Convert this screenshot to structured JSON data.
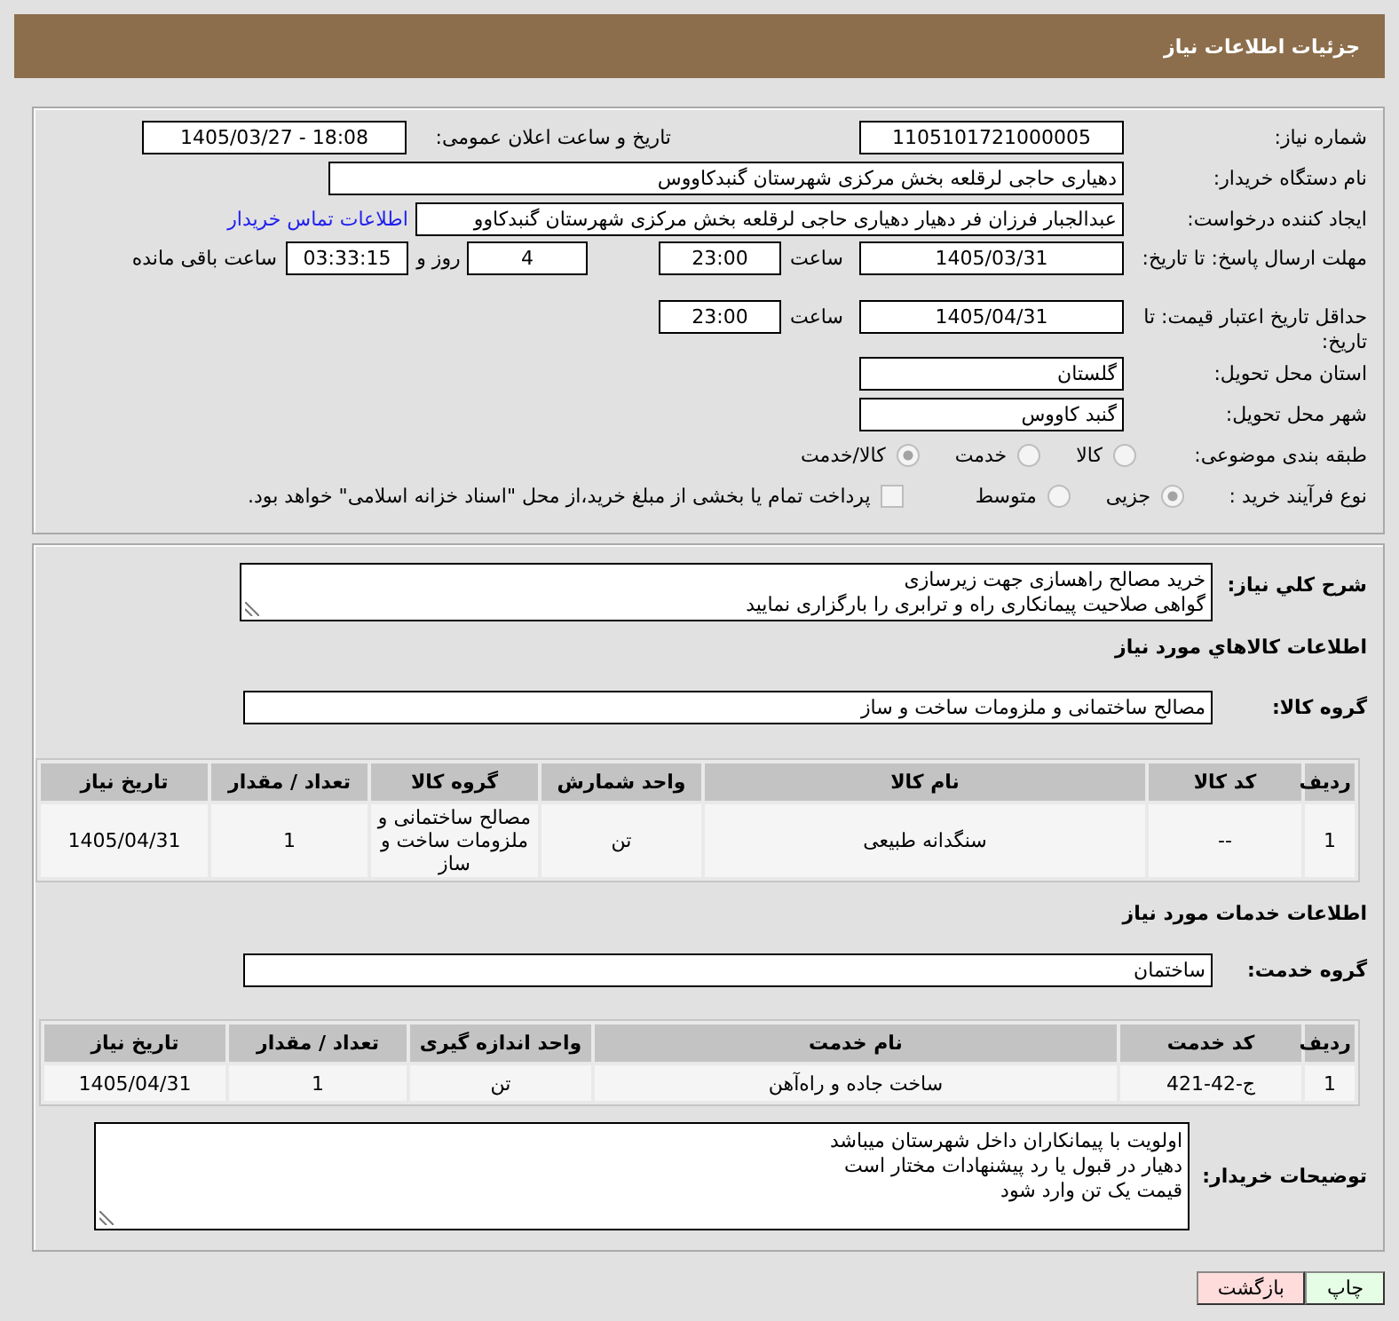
{
  "header": {
    "title": "جزئیات اطلاعات نیاز"
  },
  "need_form": {
    "need_number": {
      "label": "شماره نیاز:",
      "value": "1105101721000005"
    },
    "announcement": {
      "label": "تاریخ و ساعت اعلان عمومی:",
      "value": "1405/03/27 - 18:08"
    },
    "buyer_org": {
      "label": "نام دستگاه خریدار:",
      "value": "دهیاری حاجی لرقلعه بخش مرکزی شهرستان گنبدکاووس"
    },
    "requester": {
      "label": "ایجاد کننده درخواست:",
      "value": "عبدالجبار فرزان فر دهیار دهیاری حاجی لرقلعه بخش مرکزی شهرستان گنبدکاوو",
      "contact_link": "اطلاعات تماس خریدار"
    },
    "response_deadline": {
      "label": "مهلت ارسال پاسخ: تا تاریخ:",
      "date": "1405/03/31",
      "time_label": "ساعت",
      "time": "23:00",
      "days": "4",
      "days_label": "روز و",
      "remaining": "03:33:15",
      "remaining_label": "ساعت باقی مانده"
    },
    "price_validity": {
      "label": "حداقل تاریخ اعتبار قیمت: تا تاریخ:",
      "date": "1405/04/31",
      "time_label": "ساعت",
      "time": "23:00"
    },
    "delivery_province": {
      "label": "استان محل تحویل:",
      "value": "گلستان"
    },
    "delivery_city": {
      "label": "شهر محل تحویل:",
      "value": "گنبد کاووس"
    },
    "subject_category": {
      "label": "طبقه بندی موضوعی:",
      "options": [
        {
          "label": "کالا",
          "selected": false
        },
        {
          "label": "خدمت",
          "selected": false
        },
        {
          "label": "کالا/خدمت",
          "selected": true
        }
      ]
    },
    "purchase_process": {
      "label": "نوع فرآیند خرید :",
      "options": [
        {
          "label": "جزیی",
          "selected": true
        },
        {
          "label": "متوسط",
          "selected": false
        }
      ],
      "treasury_payment": {
        "label": "پرداخت تمام یا بخشی از مبلغ خرید،از محل \"اسناد خزانه اسلامی\" خواهد بود.",
        "checked": false
      }
    }
  },
  "details": {
    "description": {
      "label": "شرح كلي نياز:",
      "lines": [
        "خرید مصالح راهسازی جهت زیرسازی",
        "گواهی صلاحیت پیمانکاری راه و ترابری را بارگزاری نمایید"
      ]
    },
    "goods": {
      "title": "اطلاعات كالاهاي مورد نياز",
      "group_label": "گروه کالا:",
      "group": "مصالح ساختمانی و ملزومات ساخت و ساز",
      "table": {
        "columns": [
          "ردیف",
          "کد کالا",
          "نام کالا",
          "واحد شمارش",
          "گروه کالا",
          "تعداد / مقدار",
          "تاریخ نیاز"
        ],
        "rows": [
          [
            "1",
            "--",
            "سنگدانه طبیعی",
            "تن",
            "مصالح ساختمانی و ملزومات ساخت و ساز",
            "1",
            "1405/04/31"
          ]
        ]
      }
    },
    "services": {
      "title": "اطلاعات خدمات مورد نیاز",
      "group_label": "گروه خدمت:",
      "group": "ساختمان",
      "table": {
        "columns": [
          "ردیف",
          "کد خدمت",
          "نام خدمت",
          "واحد اندازه گیری",
          "تعداد / مقدار",
          "تاریخ نیاز"
        ],
        "rows": [
          [
            "1",
            "ج-42-421",
            "ساخت جاده و راه‌آهن",
            "تن",
            "1",
            "1405/04/31"
          ]
        ]
      }
    },
    "buyer_notes": {
      "label": "توضیحات خریدار:",
      "lines": [
        "اولویت با پیمانکاران داخل شهرستان میباشد",
        "دهیار در قبول یا رد پیشنهادات مختار است",
        "قیمت یک تن وارد شود"
      ]
    }
  },
  "buttons": [
    {
      "label": "چاپ",
      "kind": "print"
    },
    {
      "label": "بازگشت",
      "kind": "back"
    }
  ]
}
